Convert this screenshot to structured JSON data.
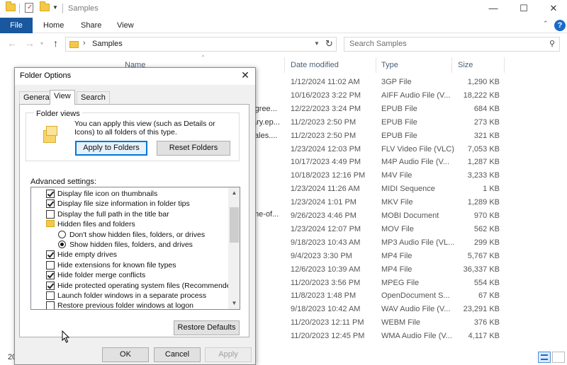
{
  "window": {
    "title": "Samples",
    "controls": {
      "minimize": "—",
      "maximize": "☐",
      "close": "✕"
    }
  },
  "ribbon": {
    "file": "File",
    "tabs": [
      "Home",
      "Share",
      "View"
    ],
    "help": "?"
  },
  "address": {
    "separator": "›",
    "path": "Samples",
    "search_placeholder": "Search Samples"
  },
  "list": {
    "columns": {
      "name": "Name",
      "date": "Date modified",
      "type": "Type",
      "size": "Size"
    },
    "rows": [
      {
        "date": "1/12/2024 11:02 AM",
        "type": "3GP File",
        "size": "1,290 KB"
      },
      {
        "date": "10/16/2023 3:22 PM",
        "type": "AIFF Audio File (V...",
        "size": "18,222 KB"
      },
      {
        "date": "12/22/2023 3:24 PM",
        "type": "EPUB File",
        "size": "684 KB"
      },
      {
        "date": "11/2/2023 2:50 PM",
        "type": "EPUB File",
        "size": "273 KB"
      },
      {
        "date": "11/2/2023 2:50 PM",
        "type": "EPUB File",
        "size": "321 KB"
      },
      {
        "date": "1/23/2024 12:03 PM",
        "type": "FLV Video File (VLC)",
        "size": "7,053 KB"
      },
      {
        "date": "10/17/2023 4:49 PM",
        "type": "M4P Audio File (V...",
        "size": "1,287 KB"
      },
      {
        "date": "10/18/2023 12:16 PM",
        "type": "M4V File",
        "size": "3,233 KB"
      },
      {
        "date": "1/23/2024 11:26 AM",
        "type": "MIDI Sequence",
        "size": "1 KB"
      },
      {
        "date": "1/23/2024 1:01 PM",
        "type": "MKV File",
        "size": "1,289 KB"
      },
      {
        "date": "9/26/2023 4:46 PM",
        "type": "MOBI Document",
        "size": "970 KB"
      },
      {
        "date": "1/23/2024 12:07 PM",
        "type": "MOV File",
        "size": "562 KB"
      },
      {
        "date": "9/18/2023 10:43 AM",
        "type": "MP3 Audio File (VL...",
        "size": "299 KB"
      },
      {
        "date": "9/4/2023 3:30 PM",
        "type": "MP4 File",
        "size": "5,767 KB"
      },
      {
        "date": "12/6/2023 10:39 AM",
        "type": "MP4 File",
        "size": "36,337 KB"
      },
      {
        "date": "11/20/2023 3:56 PM",
        "type": "MPEG File",
        "size": "554 KB"
      },
      {
        "date": "11/8/2023 1:48 PM",
        "type": "OpenDocument S...",
        "size": "67 KB"
      },
      {
        "date": "9/18/2023 10:42 AM",
        "type": "WAV Audio File (V...",
        "size": "23,291 KB"
      },
      {
        "date": "11/20/2023 12:11 PM",
        "type": "WEBM File",
        "size": "376 KB"
      },
      {
        "date": "11/20/2023 12:45 PM",
        "type": "WMA Audio File (V...",
        "size": "4,117 KB"
      }
    ],
    "name_fragments": [
      "-gree...",
      "ary.ep...",
      "tales....",
      "me-of..."
    ],
    "item_count": "20"
  },
  "dialog": {
    "title": "Folder Options",
    "close": "✕",
    "tabs": [
      "General",
      "View",
      "Search"
    ],
    "folder_views": {
      "legend": "Folder views",
      "description": "You can apply this view (such as Details or Icons) to all folders of this type.",
      "apply_button": "Apply to Folders",
      "reset_button": "Reset Folders"
    },
    "advanced_label": "Advanced settings:",
    "settings": [
      {
        "kind": "checkbox",
        "checked": true,
        "label": "Display file icon on thumbnails"
      },
      {
        "kind": "checkbox",
        "checked": true,
        "label": "Display file size information in folder tips"
      },
      {
        "kind": "checkbox",
        "checked": false,
        "label": "Display the full path in the title bar"
      },
      {
        "kind": "folder",
        "label": "Hidden files and folders"
      },
      {
        "kind": "radio",
        "checked": false,
        "label": "Don't show hidden files, folders, or drives"
      },
      {
        "kind": "radio",
        "checked": true,
        "label": "Show hidden files, folders, and drives"
      },
      {
        "kind": "checkbox",
        "checked": true,
        "label": "Hide empty drives"
      },
      {
        "kind": "checkbox",
        "checked": false,
        "label": "Hide extensions for known file types"
      },
      {
        "kind": "checkbox",
        "checked": true,
        "label": "Hide folder merge conflicts"
      },
      {
        "kind": "checkbox",
        "checked": true,
        "label": "Hide protected operating system files (Recommended)"
      },
      {
        "kind": "checkbox",
        "checked": false,
        "label": "Launch folder windows in a separate process"
      },
      {
        "kind": "checkbox",
        "checked": false,
        "label": "Restore previous folder windows at logon"
      }
    ],
    "restore_defaults": "Restore Defaults",
    "ok": "OK",
    "cancel": "Cancel",
    "apply": "Apply"
  }
}
